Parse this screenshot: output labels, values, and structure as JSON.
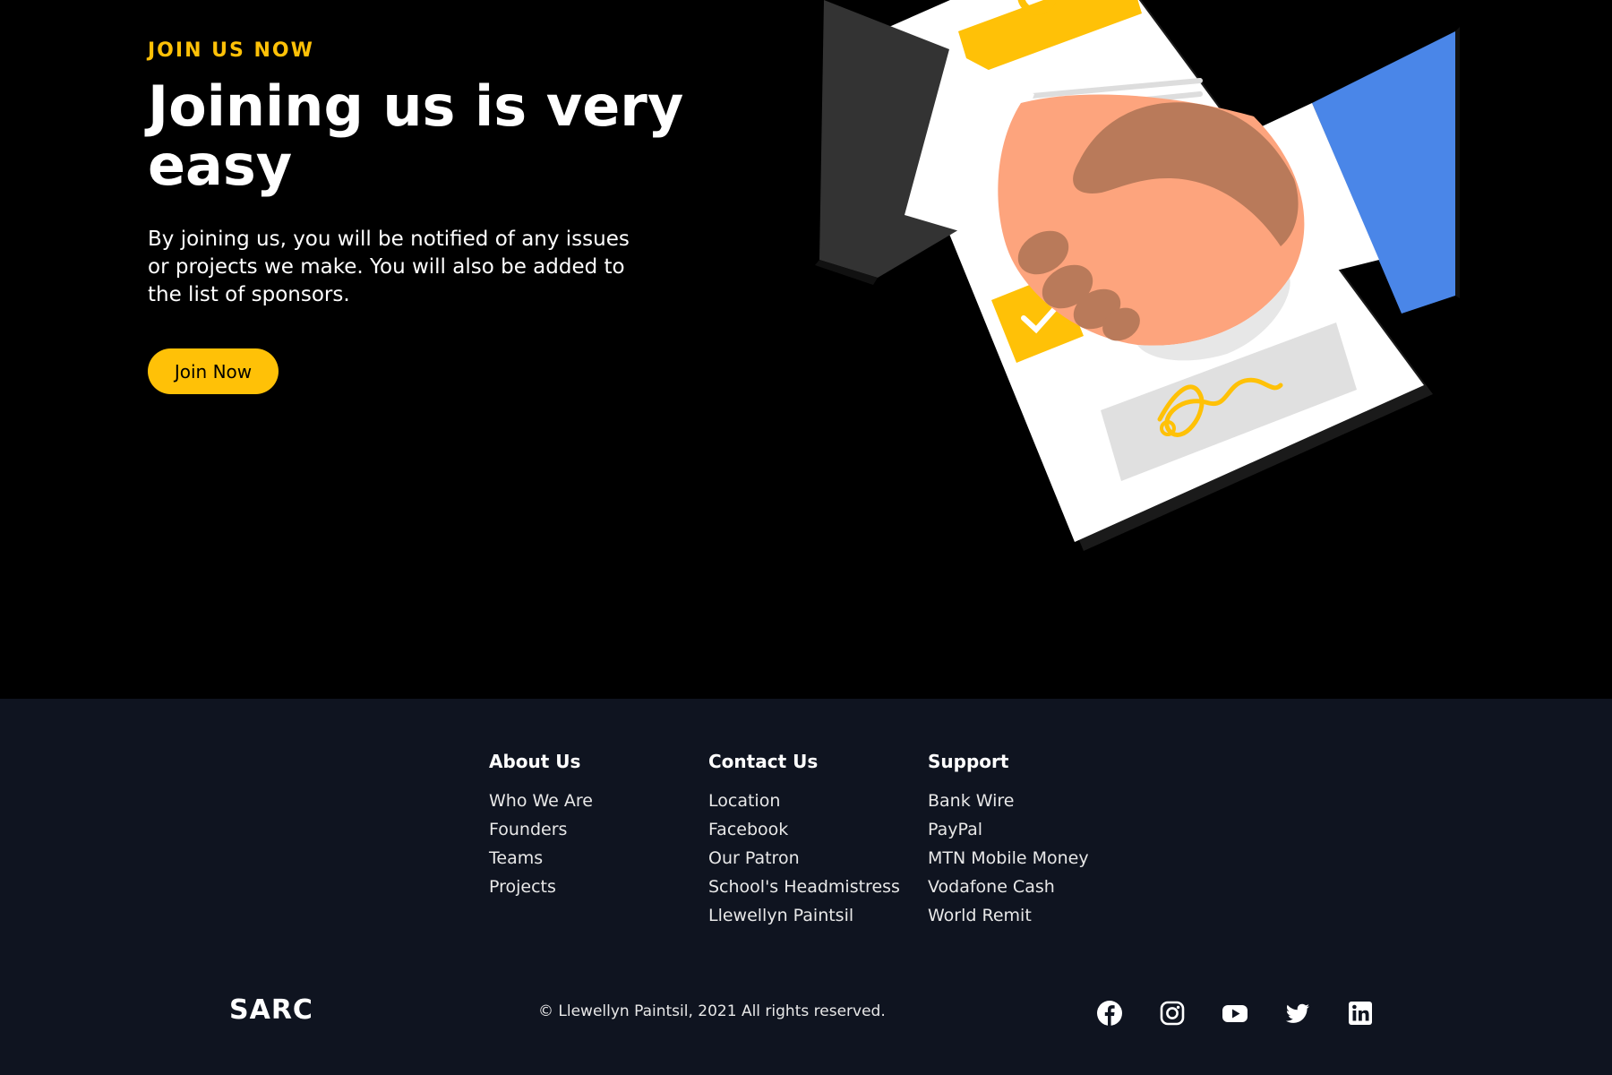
{
  "hero": {
    "eyebrow": "JOIN US NOW",
    "headline": "Joining us is very easy",
    "lead": "By joining us, you will be notified of any issues or projects we make. You will also be added to the list of sponsors.",
    "cta_label": "Join Now"
  },
  "footer": {
    "columns": [
      {
        "title": "About Us",
        "links": [
          "Who We Are",
          "Founders",
          "Teams",
          "Projects"
        ]
      },
      {
        "title": "Contact Us",
        "links": [
          "Location",
          "Facebook",
          "Our Patron",
          "School's Headmistress",
          "Llewellyn Paintsil"
        ]
      },
      {
        "title": "Support",
        "links": [
          "Bank Wire",
          "PayPal",
          "MTN Mobile Money",
          "Vodafone Cash",
          "World Remit"
        ]
      }
    ],
    "brand": "SARC",
    "copyright": "© Llewellyn Paintsil, 2021 All rights reserved.",
    "socials": [
      "facebook-icon",
      "instagram-icon",
      "youtube-icon",
      "twitter-icon",
      "linkedin-icon"
    ]
  },
  "colors": {
    "accent": "#ffc107",
    "hero_bg": "#000000",
    "footer_bg": "#0f1420",
    "skin_light": "#fda47d",
    "skin_dark": "#b97a5a",
    "sleeve_blue": "#4a86e8",
    "sleeve_dark": "#333333"
  }
}
